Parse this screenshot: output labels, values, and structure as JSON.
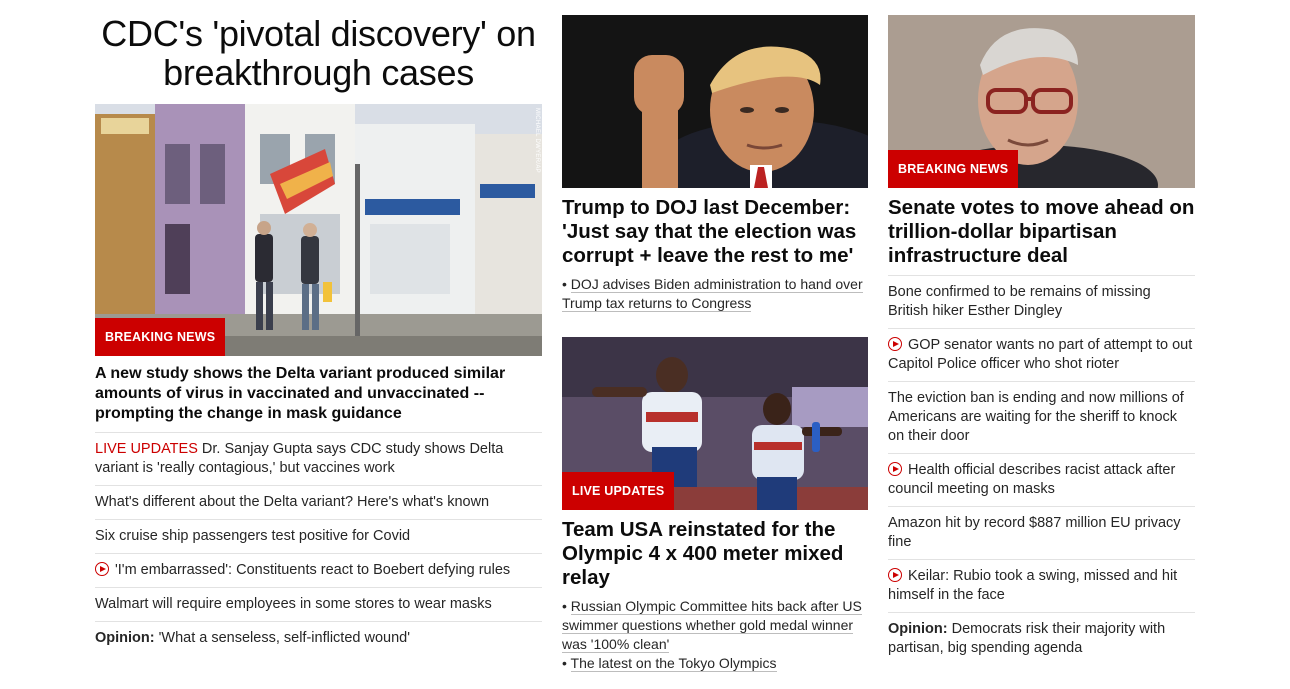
{
  "left": {
    "headline": "CDC's 'pivotal discovery' on breakthrough cases",
    "image_alt": "Two people wearing masks walking past storefronts",
    "image_credit": "MICHAEL DWYER/AP",
    "badge": "BREAKING NEWS",
    "lead": "A new study shows the Delta variant produced similar amounts of virus in vaccinated and unvaccinated -- prompting the change in mask guidance",
    "items": [
      {
        "prefix": "LIVE UPDATES",
        "text": " Dr. Sanjay Gupta says CDC study shows Delta variant is 'really contagious,' but vaccines work",
        "video": false
      },
      {
        "text": "What's different about the Delta variant? Here's what's known",
        "video": false
      },
      {
        "text": "Six cruise ship passengers test positive for Covid",
        "video": false
      },
      {
        "text": "'I'm embarrassed': Constituents react to Boebert defying rules",
        "video": true
      },
      {
        "text": "Walmart will require employees in some stores to wear masks",
        "video": false
      },
      {
        "bold": "Opinion:",
        "text": " 'What a senseless, self-inflicted wound'",
        "video": false
      }
    ]
  },
  "middle": {
    "story1": {
      "title": "Trump to DOJ last December: 'Just say that the election was corrupt + leave the rest to me'",
      "bullet": "DOJ advises Biden administration to hand over Trump tax returns to Congress"
    },
    "story2": {
      "badge": "LIVE UPDATES",
      "title": "Team USA reinstated for the Olympic 4 x 400 meter mixed relay",
      "bullets": [
        "Russian Olympic Committee hits back after US swimmer questions whether gold medal winner was '100% clean'",
        "The latest on the Tokyo Olympics"
      ]
    }
  },
  "right": {
    "badge": "BREAKING NEWS",
    "title": "Senate votes to move ahead on trillion-dollar bipartisan infrastructure deal",
    "items": [
      {
        "text": "Bone confirmed to be remains of missing British hiker Esther Dingley",
        "video": false
      },
      {
        "text": "GOP senator wants no part of attempt to out Capitol Police officer who shot rioter",
        "video": true
      },
      {
        "text": "The eviction ban is ending and now millions of Americans are waiting for the sheriff to knock on their door",
        "video": false
      },
      {
        "text": "Health official describes racist attack after council meeting on masks",
        "video": true
      },
      {
        "text": "Amazon hit by record $887 million EU privacy fine",
        "video": false
      },
      {
        "text": "Keilar: Rubio took a swing, missed and hit himself in the face",
        "video": true
      },
      {
        "bold": "Opinion:",
        "text": " Democrats risk their majority with partisan, big spending agenda",
        "video": false
      }
    ]
  },
  "colors": {
    "accent": "#cc0000",
    "divider": "#e2e2e2",
    "text": "#262626"
  }
}
